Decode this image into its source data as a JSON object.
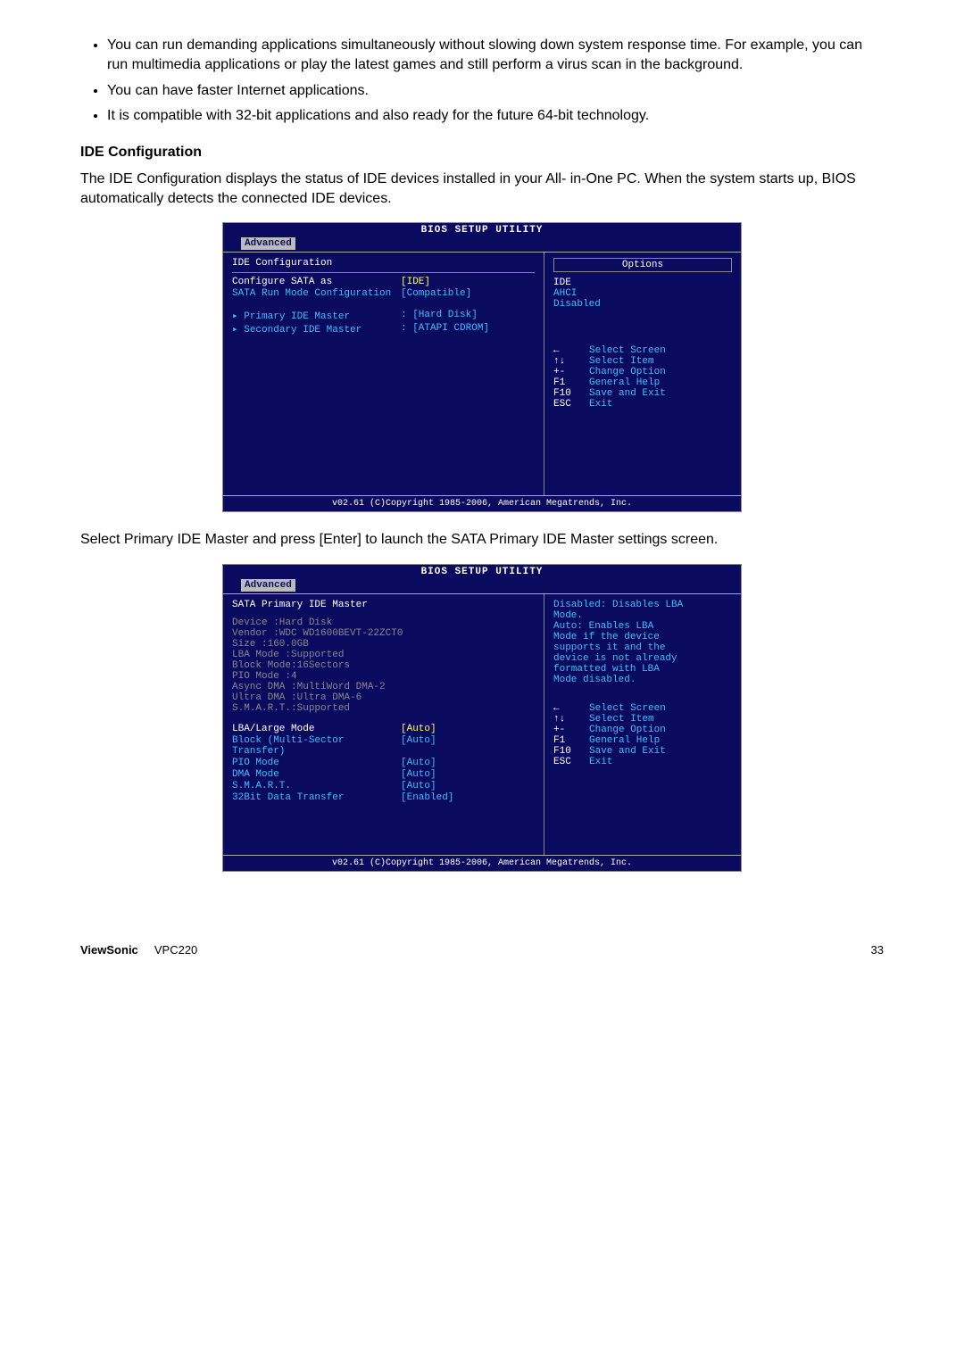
{
  "bullets": [
    "You can run demanding applications simultaneously without slowing down system response time. For example, you can run multimedia applications or play the latest games and still perform a virus scan in the background.",
    "You can have faster Internet applications.",
    "It is compatible with 32-bit applications and also ready for the future 64-bit technology."
  ],
  "section_heading": "IDE Configuration",
  "section_para": "The IDE Configuration displays the status of IDE devices installed in your All- in-One PC. When the system starts up, BIOS automatically detects the connected IDE devices.",
  "bios1": {
    "title": "BIOS SETUP UTILITY",
    "tab": "Advanced",
    "panel_title": "IDE Configuration",
    "rows": [
      {
        "label": "Configure SATA as",
        "value": "[IDE]",
        "labelClass": "bios-white",
        "valClass": "bios-yellow"
      },
      {
        "label": "SATA Run Mode Configuration",
        "value": "[Compatible]",
        "labelClass": "bios-cyan",
        "valClass": "bios-cyan"
      }
    ],
    "subrows": [
      {
        "label": "▸ Primary IDE Master",
        "value": ": [Hard Disk]"
      },
      {
        "label": "▸ Secondary IDE Master",
        "value": ": [ATAPI CDROM]"
      }
    ],
    "options_head": "Options",
    "options": [
      "IDE",
      "AHCI",
      "Disabled"
    ],
    "legend": [
      {
        "k": "←",
        "v": "Select Screen"
      },
      {
        "k": "↑↓",
        "v": "Select Item"
      },
      {
        "k": "+-",
        "v": "Change Option"
      },
      {
        "k": "F1",
        "v": "General Help"
      },
      {
        "k": "F10",
        "v": "Save and Exit"
      },
      {
        "k": "ESC",
        "v": "Exit"
      }
    ],
    "footer": "v02.61 (C)Copyright 1985-2006, American Megatrends, Inc."
  },
  "mid_para": "Select Primary IDE Master and press [Enter] to launch the SATA Primary IDE Master settings screen.",
  "bios2": {
    "title": "BIOS SETUP UTILITY",
    "tab": "Advanced",
    "panel_title": "SATA Primary IDE Master",
    "info": [
      "Device    :Hard Disk",
      "Vendor    :WDC WD1600BEVT-22ZCT0",
      "Size      :160.0GB",
      "LBA Mode  :Supported",
      "Block Mode:16Sectors",
      "PIO Mode  :4",
      "Async DMA :MultiWord DMA-2",
      "Ultra DMA :Ultra DMA-6",
      "S.M.A.R.T.:Supported"
    ],
    "settings": [
      {
        "label": "LBA/Large Mode",
        "value": "[Auto]",
        "labelClass": "bios-white",
        "valClass": "bios-yellow"
      },
      {
        "label": "Block (Multi-Sector Transfer)",
        "value": "[Auto]",
        "labelClass": "bios-cyan",
        "valClass": "bios-cyan"
      },
      {
        "label": "PIO Mode",
        "value": "[Auto]",
        "labelClass": "bios-cyan",
        "valClass": "bios-cyan"
      },
      {
        "label": "DMA Mode",
        "value": "[Auto]",
        "labelClass": "bios-cyan",
        "valClass": "bios-cyan"
      },
      {
        "label": "S.M.A.R.T.",
        "value": "[Auto]",
        "labelClass": "bios-cyan",
        "valClass": "bios-cyan"
      },
      {
        "label": "32Bit Data Transfer",
        "value": "[Enabled]",
        "labelClass": "bios-cyan",
        "valClass": "bios-cyan"
      }
    ],
    "help_lines": [
      "Disabled: Disables LBA",
      "Mode.",
      "Auto: Enables LBA",
      "Mode if the device",
      "supports it and the",
      "device is not already",
      "formatted with LBA",
      "Mode disabled."
    ],
    "legend": [
      {
        "k": "←",
        "v": "Select Screen"
      },
      {
        "k": "↑↓",
        "v": "Select Item"
      },
      {
        "k": "+-",
        "v": "Change Option"
      },
      {
        "k": "F1",
        "v": "General Help"
      },
      {
        "k": "F10",
        "v": "Save and Exit"
      },
      {
        "k": "ESC",
        "v": "Exit"
      }
    ],
    "footer": "v02.61 (C)Copyright 1985-2006, American Megatrends, Inc."
  },
  "footer": {
    "brand": "ViewSonic",
    "model": "VPC220",
    "page": "33"
  }
}
